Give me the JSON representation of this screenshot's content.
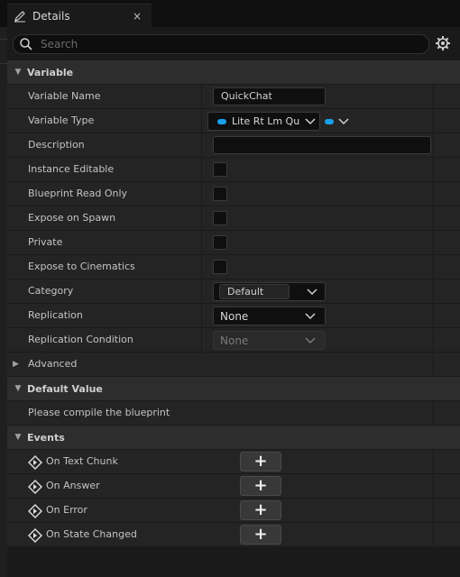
{
  "tab": {
    "title": "Details",
    "close": "×"
  },
  "search": {
    "placeholder": "Search"
  },
  "sections": {
    "variable": "Variable",
    "default_value": "Default Value",
    "events": "Events",
    "advanced": "Advanced"
  },
  "properties": {
    "variable_name": {
      "label": "Variable Name",
      "value": "QuickChat"
    },
    "variable_type": {
      "label": "Variable Type",
      "value": "Lite Rt Lm Qu"
    },
    "description": {
      "label": "Description",
      "value": ""
    },
    "instance_editable": {
      "label": "Instance Editable"
    },
    "blueprint_read_only": {
      "label": "Blueprint Read Only"
    },
    "expose_on_spawn": {
      "label": "Expose on Spawn"
    },
    "private": {
      "label": "Private"
    },
    "expose_to_cinematics": {
      "label": "Expose to Cinematics"
    },
    "category": {
      "label": "Category",
      "value": "Default"
    },
    "replication": {
      "label": "Replication",
      "value": "None"
    },
    "replication_condition": {
      "label": "Replication Condition",
      "value": "None"
    }
  },
  "default_value": {
    "message": "Please compile the blueprint"
  },
  "events": [
    {
      "label": "On Text Chunk"
    },
    {
      "label": "On Answer"
    },
    {
      "label": "On Error"
    },
    {
      "label": "On State Changed"
    }
  ],
  "colors": {
    "type_pill": "#1aa0ea",
    "background": "#1a1a1a",
    "row": "#242424",
    "section": "#2d2d2d"
  },
  "icons": {
    "tab": "pencil-icon",
    "search": "search-icon",
    "settings": "gear-icon",
    "event": "event-diamond-icon",
    "add": "plus-icon"
  }
}
